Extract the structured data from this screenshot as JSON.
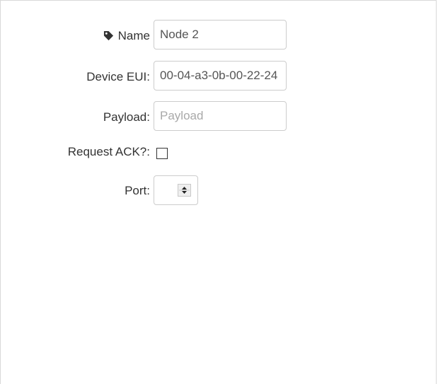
{
  "form": {
    "name": {
      "label": "Name",
      "icon": "tag-icon",
      "value": "Node 2"
    },
    "device_eui": {
      "label": "Device EUI:",
      "value": "00-04-a3-0b-00-22-24"
    },
    "payload": {
      "label": "Payload:",
      "value": "",
      "placeholder": "Payload"
    },
    "request_ack": {
      "label": "Request ACK?:",
      "checked": false
    },
    "port": {
      "label": "Port:",
      "value": ""
    }
  }
}
